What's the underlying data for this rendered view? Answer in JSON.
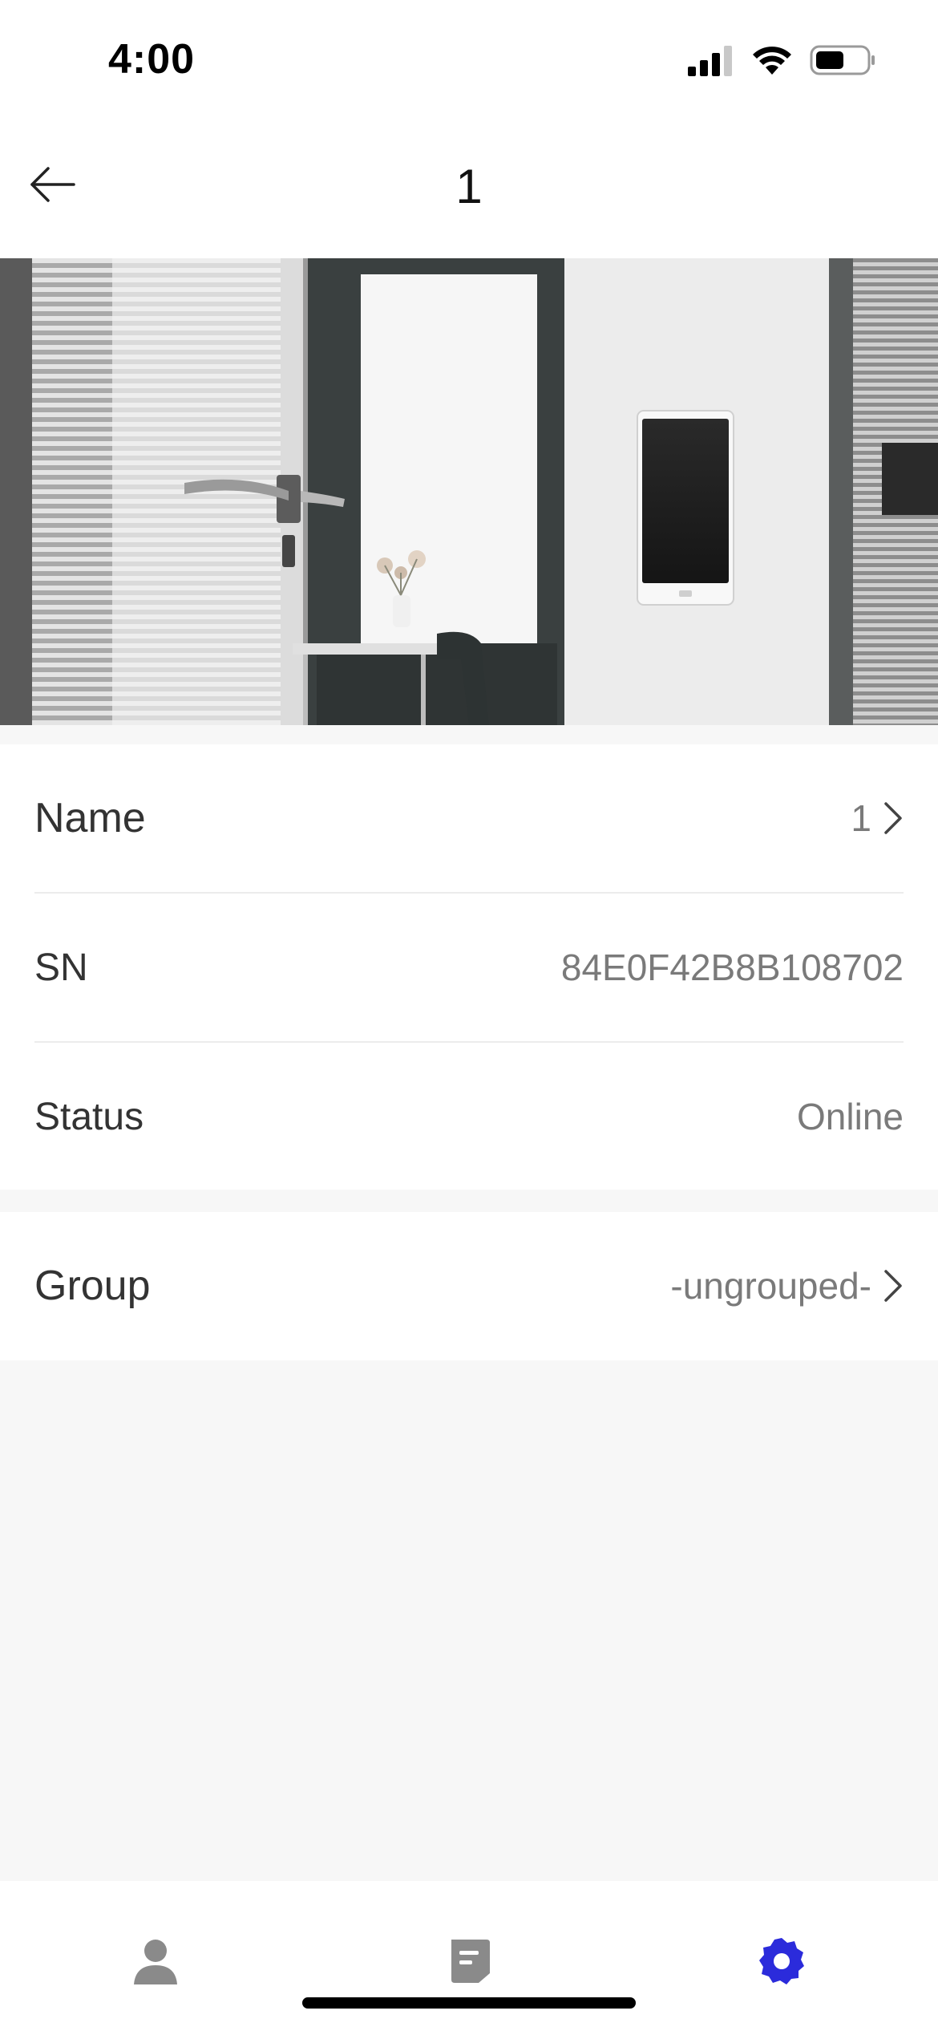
{
  "status_bar": {
    "time": "4:00"
  },
  "header": {
    "title": "1",
    "back_icon": "arrow-left-icon"
  },
  "device_info": {
    "rows": [
      {
        "label": "Name",
        "value": "1",
        "has_chevron": true
      },
      {
        "label": "SN",
        "value": "84E0F42B8B108702",
        "has_chevron": false
      },
      {
        "label": "Status",
        "value": "Online",
        "has_chevron": false
      }
    ]
  },
  "group": {
    "label": "Group",
    "value": "-ungrouped-"
  },
  "bottom_nav": {
    "items": [
      {
        "icon": "person-icon",
        "active": false
      },
      {
        "icon": "document-icon",
        "active": false
      },
      {
        "icon": "settings-gear-icon",
        "active": true
      }
    ]
  },
  "colors": {
    "accent": "#2b2bdb",
    "inactive_icon": "#8a8a8a",
    "label_text": "#333333",
    "value_text": "#7a7a7a",
    "background": "#f7f7f7"
  }
}
